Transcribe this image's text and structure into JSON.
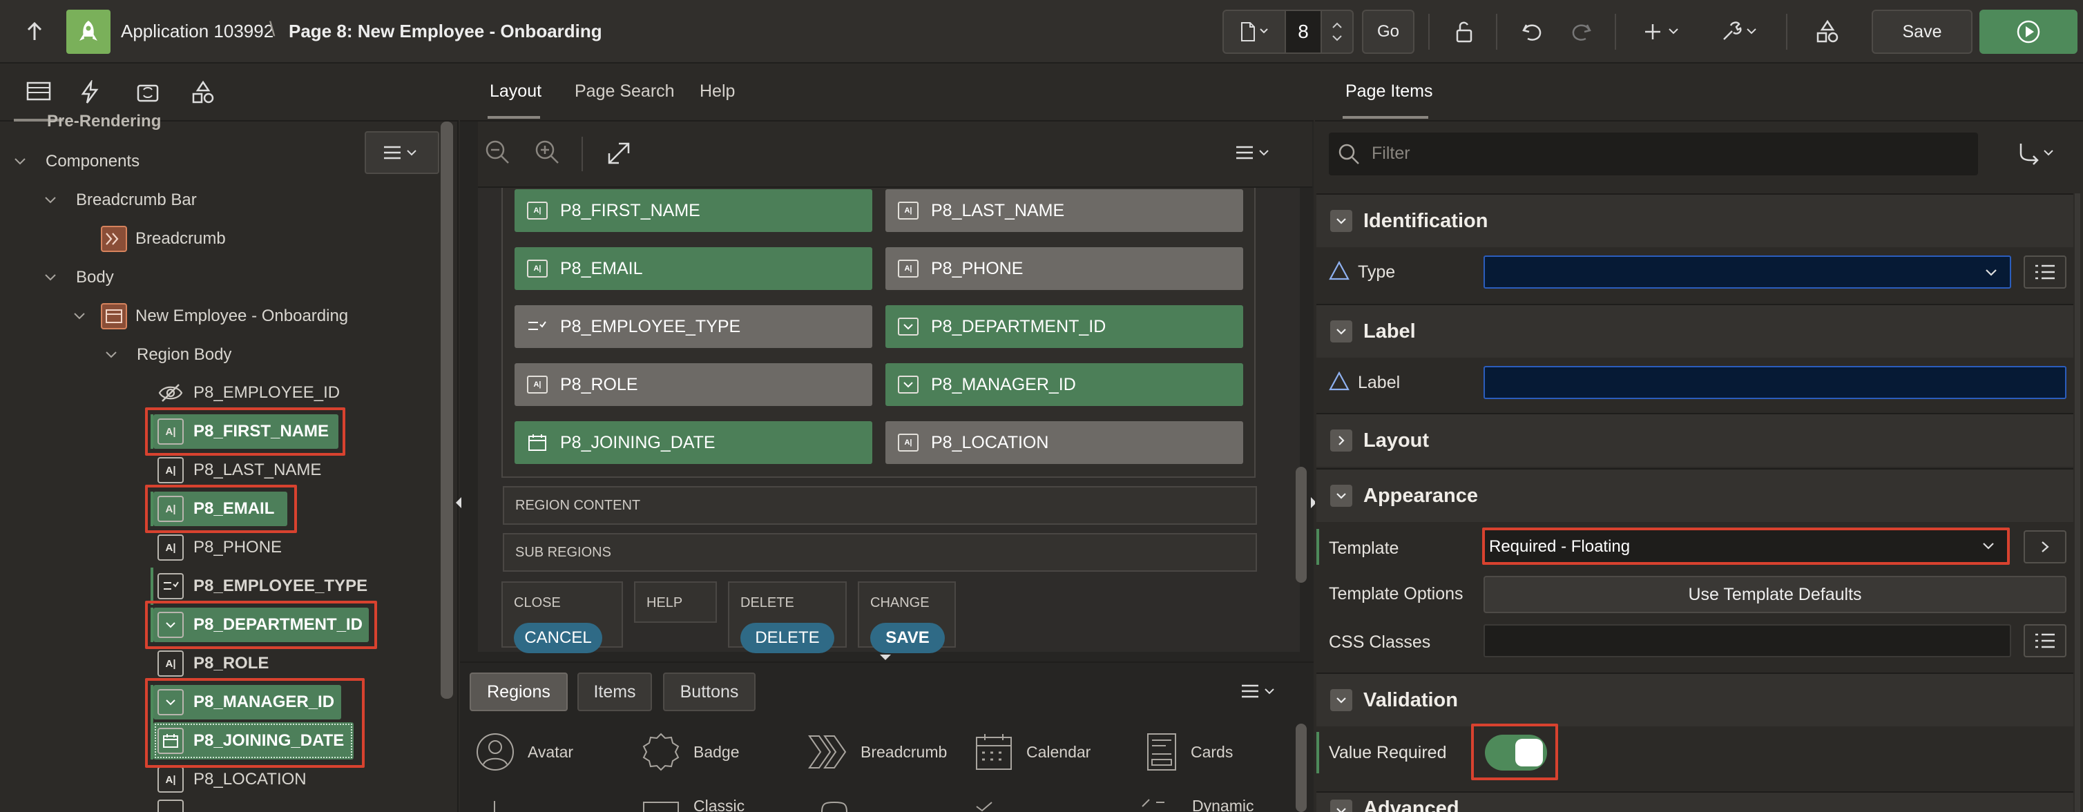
{
  "topbar": {
    "app_title": "Application 103992",
    "separator": "\\",
    "page_title": "Page 8: New Employee - Onboarding",
    "page_number": "8",
    "go_label": "Go",
    "save_label": "Save"
  },
  "left": {
    "prerendering": "Pre-Rendering",
    "components": "Components",
    "breadcrumb_bar": "Breadcrumb Bar",
    "breadcrumb": "Breadcrumb",
    "body": "Body",
    "region": "New Employee - Onboarding",
    "region_body": "Region Body",
    "items": [
      {
        "name": "P8_EMPLOYEE_ID",
        "icon": "hidden-item-icon",
        "highlighted": false
      },
      {
        "name": "P8_FIRST_NAME",
        "icon": "text-field-icon",
        "highlighted": true
      },
      {
        "name": "P8_LAST_NAME",
        "icon": "text-field-icon",
        "highlighted": false
      },
      {
        "name": "P8_EMAIL",
        "icon": "text-field-icon",
        "highlighted": true
      },
      {
        "name": "P8_PHONE",
        "icon": "text-field-icon",
        "highlighted": false
      },
      {
        "name": "P8_EMPLOYEE_TYPE",
        "icon": "radio-group-icon",
        "highlighted": false
      },
      {
        "name": "P8_DEPARTMENT_ID",
        "icon": "select-list-icon",
        "highlighted": true
      },
      {
        "name": "P8_ROLE",
        "icon": "text-field-icon",
        "highlighted": false
      },
      {
        "name": "P8_MANAGER_ID",
        "icon": "select-list-icon",
        "highlighted": true
      },
      {
        "name": "P8_JOINING_DATE",
        "icon": "date-picker-icon",
        "highlighted": true
      },
      {
        "name": "P8_LOCATION",
        "icon": "text-field-icon",
        "highlighted": false
      }
    ]
  },
  "center": {
    "tabs": [
      "Layout",
      "Page Search",
      "Help"
    ],
    "grid_items": [
      {
        "name": "P8_FIRST_NAME",
        "icon": "text-field-icon",
        "style": "green"
      },
      {
        "name": "P8_LAST_NAME",
        "icon": "text-field-icon",
        "style": "gray"
      },
      {
        "name": "P8_EMAIL",
        "icon": "text-field-icon",
        "style": "green"
      },
      {
        "name": "P8_PHONE",
        "icon": "text-field-icon",
        "style": "gray"
      },
      {
        "name": "P8_EMPLOYEE_TYPE",
        "icon": "radio-group-icon",
        "style": "gray"
      },
      {
        "name": "P8_DEPARTMENT_ID",
        "icon": "select-list-icon",
        "style": "green"
      },
      {
        "name": "P8_ROLE",
        "icon": "text-field-icon",
        "style": "gray"
      },
      {
        "name": "P8_MANAGER_ID",
        "icon": "select-list-icon",
        "style": "green"
      },
      {
        "name": "P8_JOINING_DATE",
        "icon": "date-picker-icon",
        "style": "green"
      },
      {
        "name": "P8_LOCATION",
        "icon": "text-field-icon",
        "style": "gray"
      }
    ],
    "region_content": "REGION CONTENT",
    "sub_regions": "SUB REGIONS",
    "slots": [
      {
        "label": "CLOSE",
        "button": "CANCEL"
      },
      {
        "label": "HELP",
        "button": ""
      },
      {
        "label": "DELETE",
        "button": "DELETE"
      },
      {
        "label": "CHANGE",
        "button": "SAVE"
      }
    ],
    "gallery_tabs": [
      "Regions",
      "Items",
      "Buttons"
    ],
    "gallery_items": [
      {
        "label": "Avatar",
        "icon": "avatar-icon"
      },
      {
        "label": "Badge",
        "icon": "badge-icon"
      },
      {
        "label": "Breadcrumb",
        "icon": "breadcrumb-icon"
      },
      {
        "label": "Calendar",
        "icon": "calendar-icon"
      },
      {
        "label": "Cards",
        "icon": "cards-icon"
      },
      {
        "label": "Classic",
        "icon": "classic-report-icon"
      },
      {
        "label": "Dynamic",
        "icon": "dynamic-content-icon"
      }
    ]
  },
  "right": {
    "tab": "Page Items",
    "filter_placeholder": "Filter",
    "sections": {
      "identification": "Identification",
      "label": "Label",
      "layout": "Layout",
      "appearance": "Appearance",
      "validation": "Validation",
      "advanced": "Advanced"
    },
    "type_label": "Type",
    "label_label": "Label",
    "template_label": "Template",
    "template_value": "Required - Floating",
    "template_options_label": "Template Options",
    "template_options_button": "Use Template Defaults",
    "css_classes_label": "CSS Classes",
    "value_required_label": "Value Required",
    "value_required_on": true
  },
  "colors": {
    "highlight_green": "#4d7f5a",
    "annotation_red": "#d8422f",
    "run_button": "#4e8a5a"
  }
}
